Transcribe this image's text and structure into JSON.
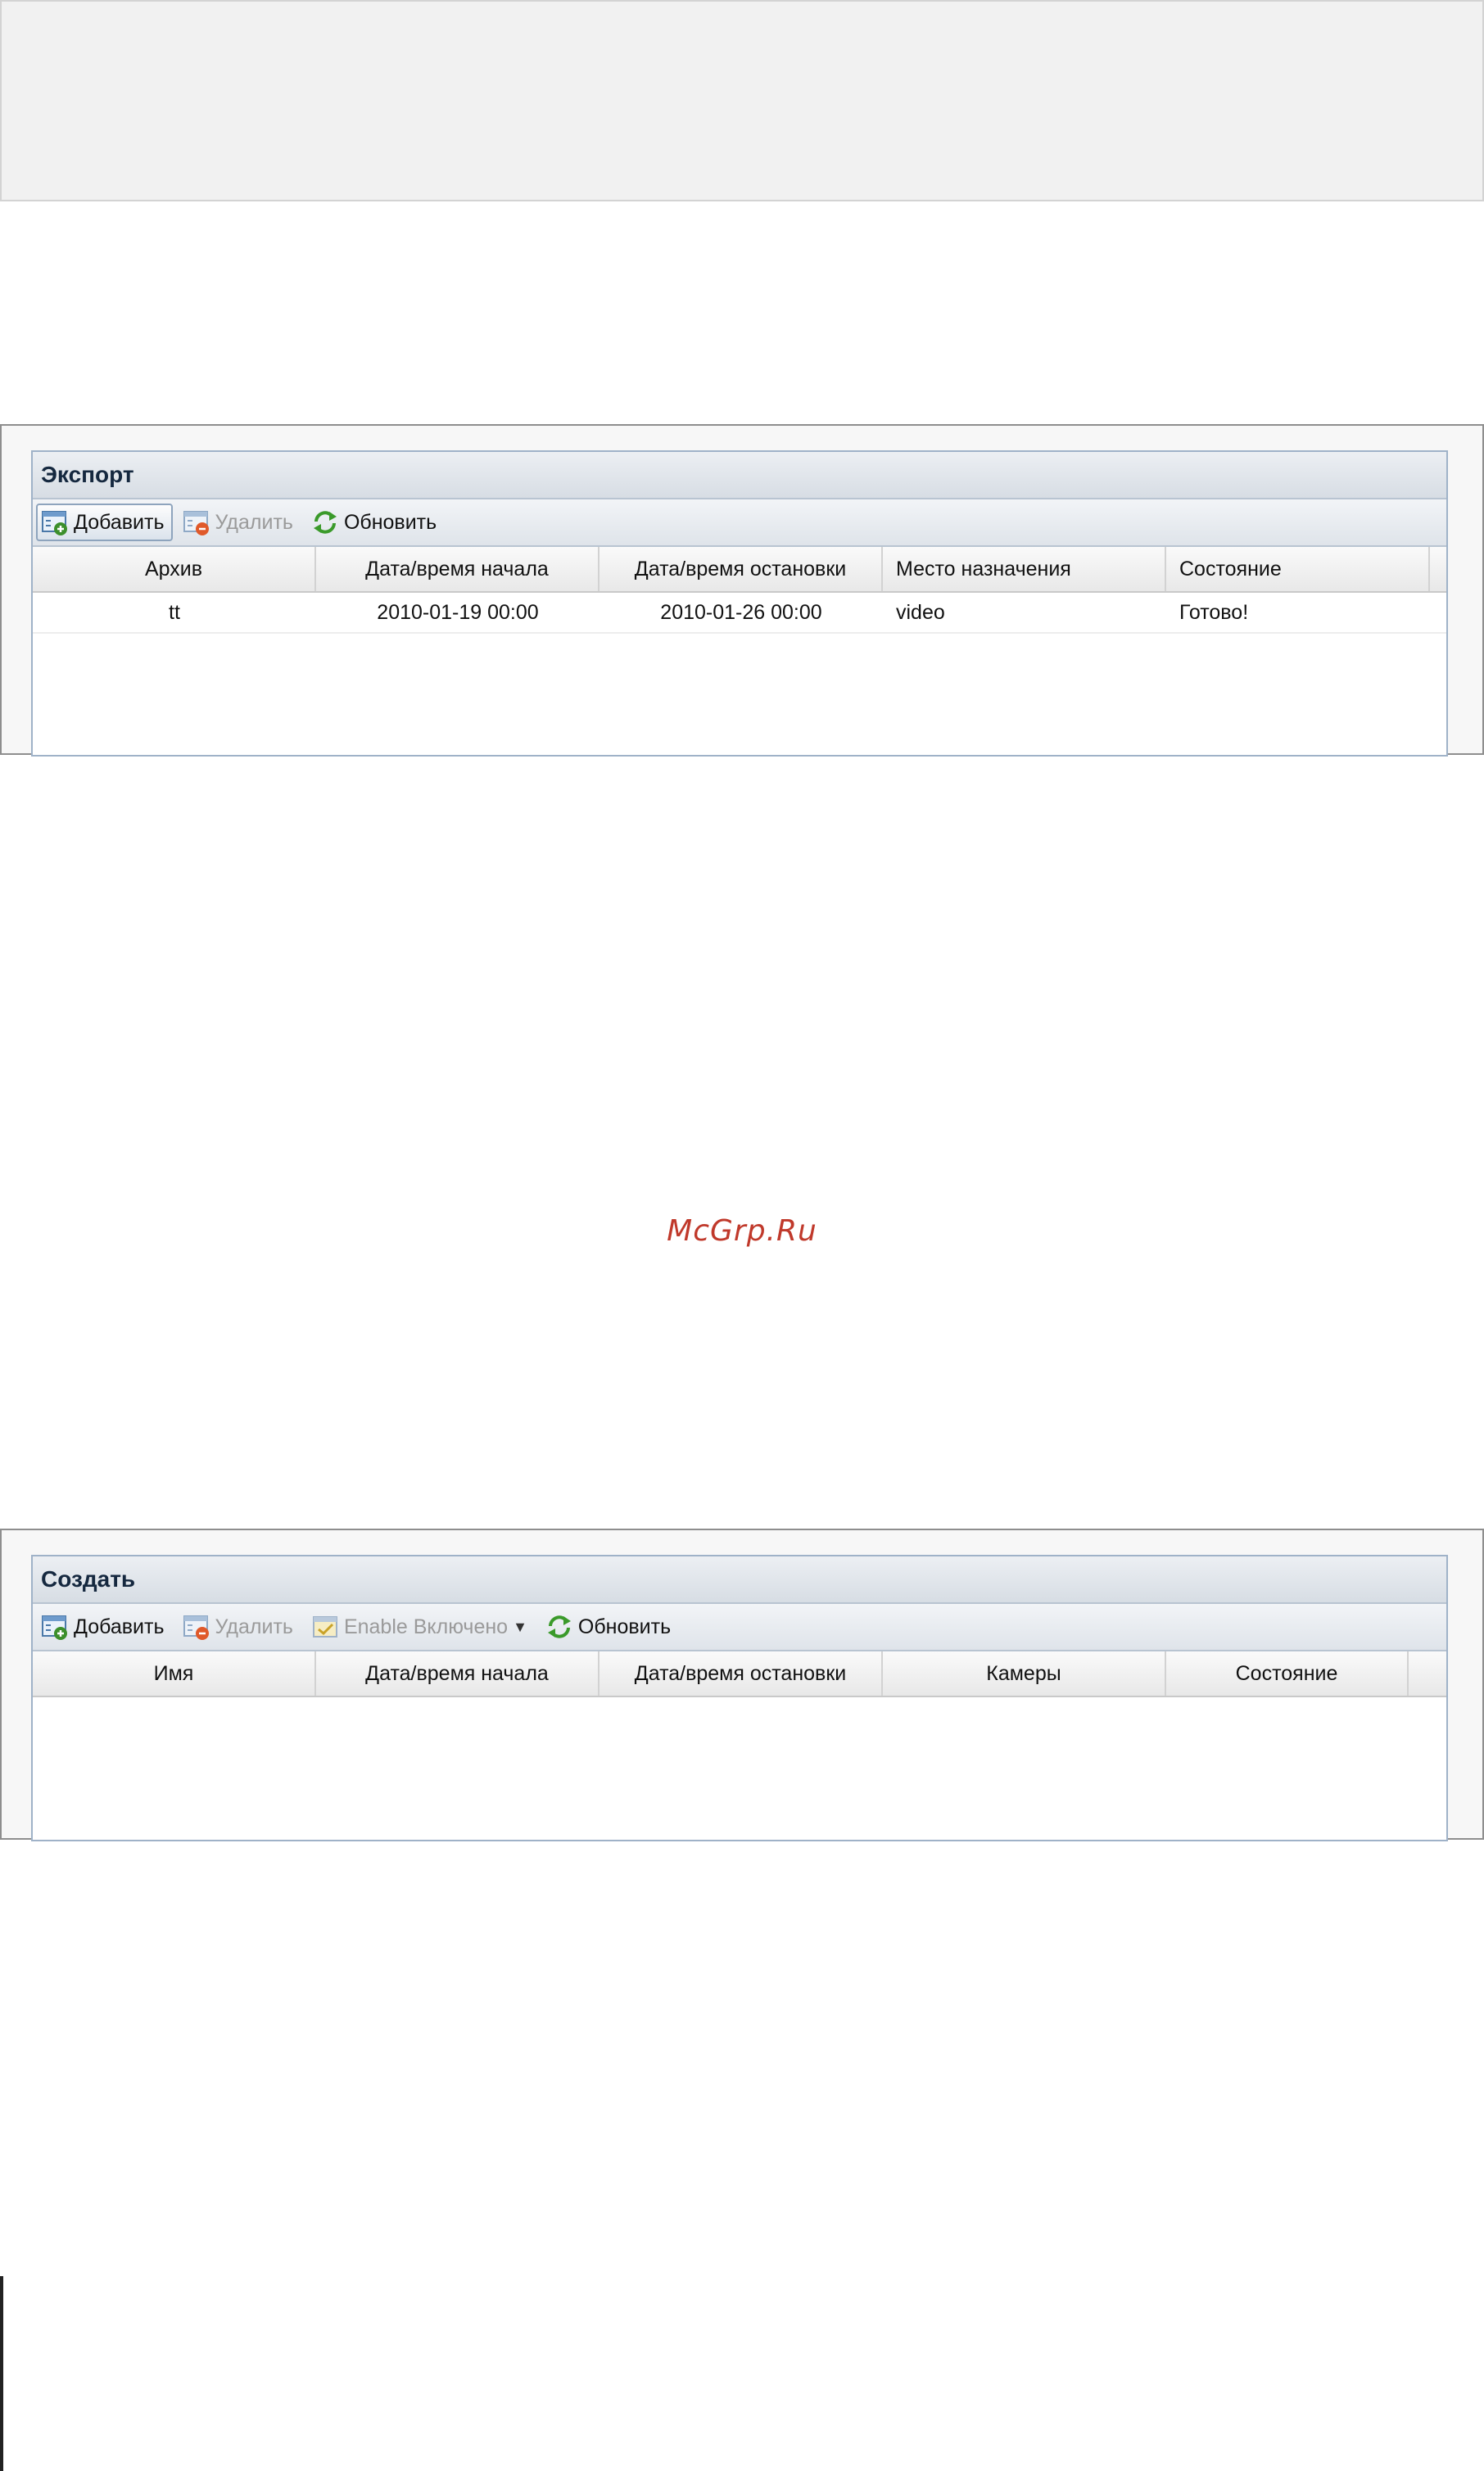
{
  "watermark": "McGrp.Ru",
  "export_panel": {
    "title": "Экспорт",
    "toolbar": {
      "add_label": "Добавить",
      "delete_label": "Удалить",
      "refresh_label": "Обновить"
    },
    "columns": [
      "Архив",
      "Дата/время начала",
      "Дата/время остановки",
      "Место назначения",
      "Состояние"
    ],
    "rows": [
      [
        "tt",
        "2010-01-19 00:00",
        "2010-01-26 00:00",
        "video",
        "Готово!"
      ]
    ]
  },
  "create_panel": {
    "title": "Создать",
    "toolbar": {
      "add_label": "Добавить",
      "delete_label": "Удалить",
      "enable_label": "Enable Включено",
      "refresh_label": "Обновить"
    },
    "columns": [
      "Имя",
      "Дата/время начала",
      "Дата/время остановки",
      "Камеры",
      "Состояние"
    ],
    "rows": []
  },
  "colors": {
    "title_text": "#15283f",
    "panel_border": "#9fb2c8",
    "watermark": "#c0392b",
    "refresh_icon": "#3a9a2a",
    "delete_icon": "#e0592a",
    "add_icon": "#3c8f2b"
  },
  "icons": {
    "add": "add-list-icon",
    "delete": "delete-list-icon",
    "refresh": "refresh-icon",
    "enable": "enable-icon"
  }
}
